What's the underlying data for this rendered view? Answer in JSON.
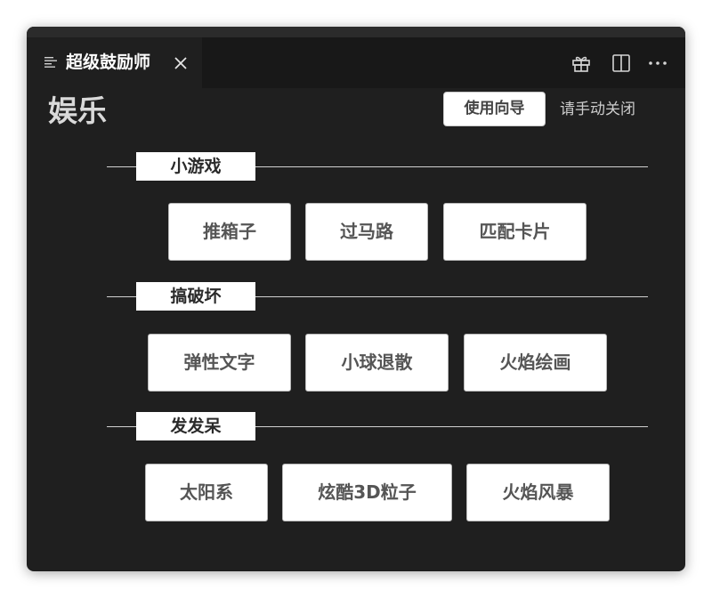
{
  "tab": {
    "title": "超级鼓励师"
  },
  "header": {
    "title": "娱乐",
    "guide_button": "使用向导",
    "close_hint": "请手动关闭"
  },
  "sections": [
    {
      "title": "小游戏",
      "items": [
        "推箱子",
        "过马路",
        "匹配卡片"
      ]
    },
    {
      "title": "搞破坏",
      "items": [
        "弹性文字",
        "小球退散",
        "火焰绘画"
      ]
    },
    {
      "title": "发发呆",
      "items": [
        "太阳系",
        "炫酷3D粒子",
        "火焰风暴"
      ]
    }
  ],
  "icons": {
    "tab": "preview-lines-icon",
    "close": "close-icon",
    "gift": "gift-icon",
    "split": "split-editor-icon",
    "more": "more-icon"
  },
  "colors": {
    "window_bg": "#1f1f1f",
    "tab_bar_bg": "#181818",
    "button_bg": "#ffffff",
    "button_text": "#555555"
  }
}
